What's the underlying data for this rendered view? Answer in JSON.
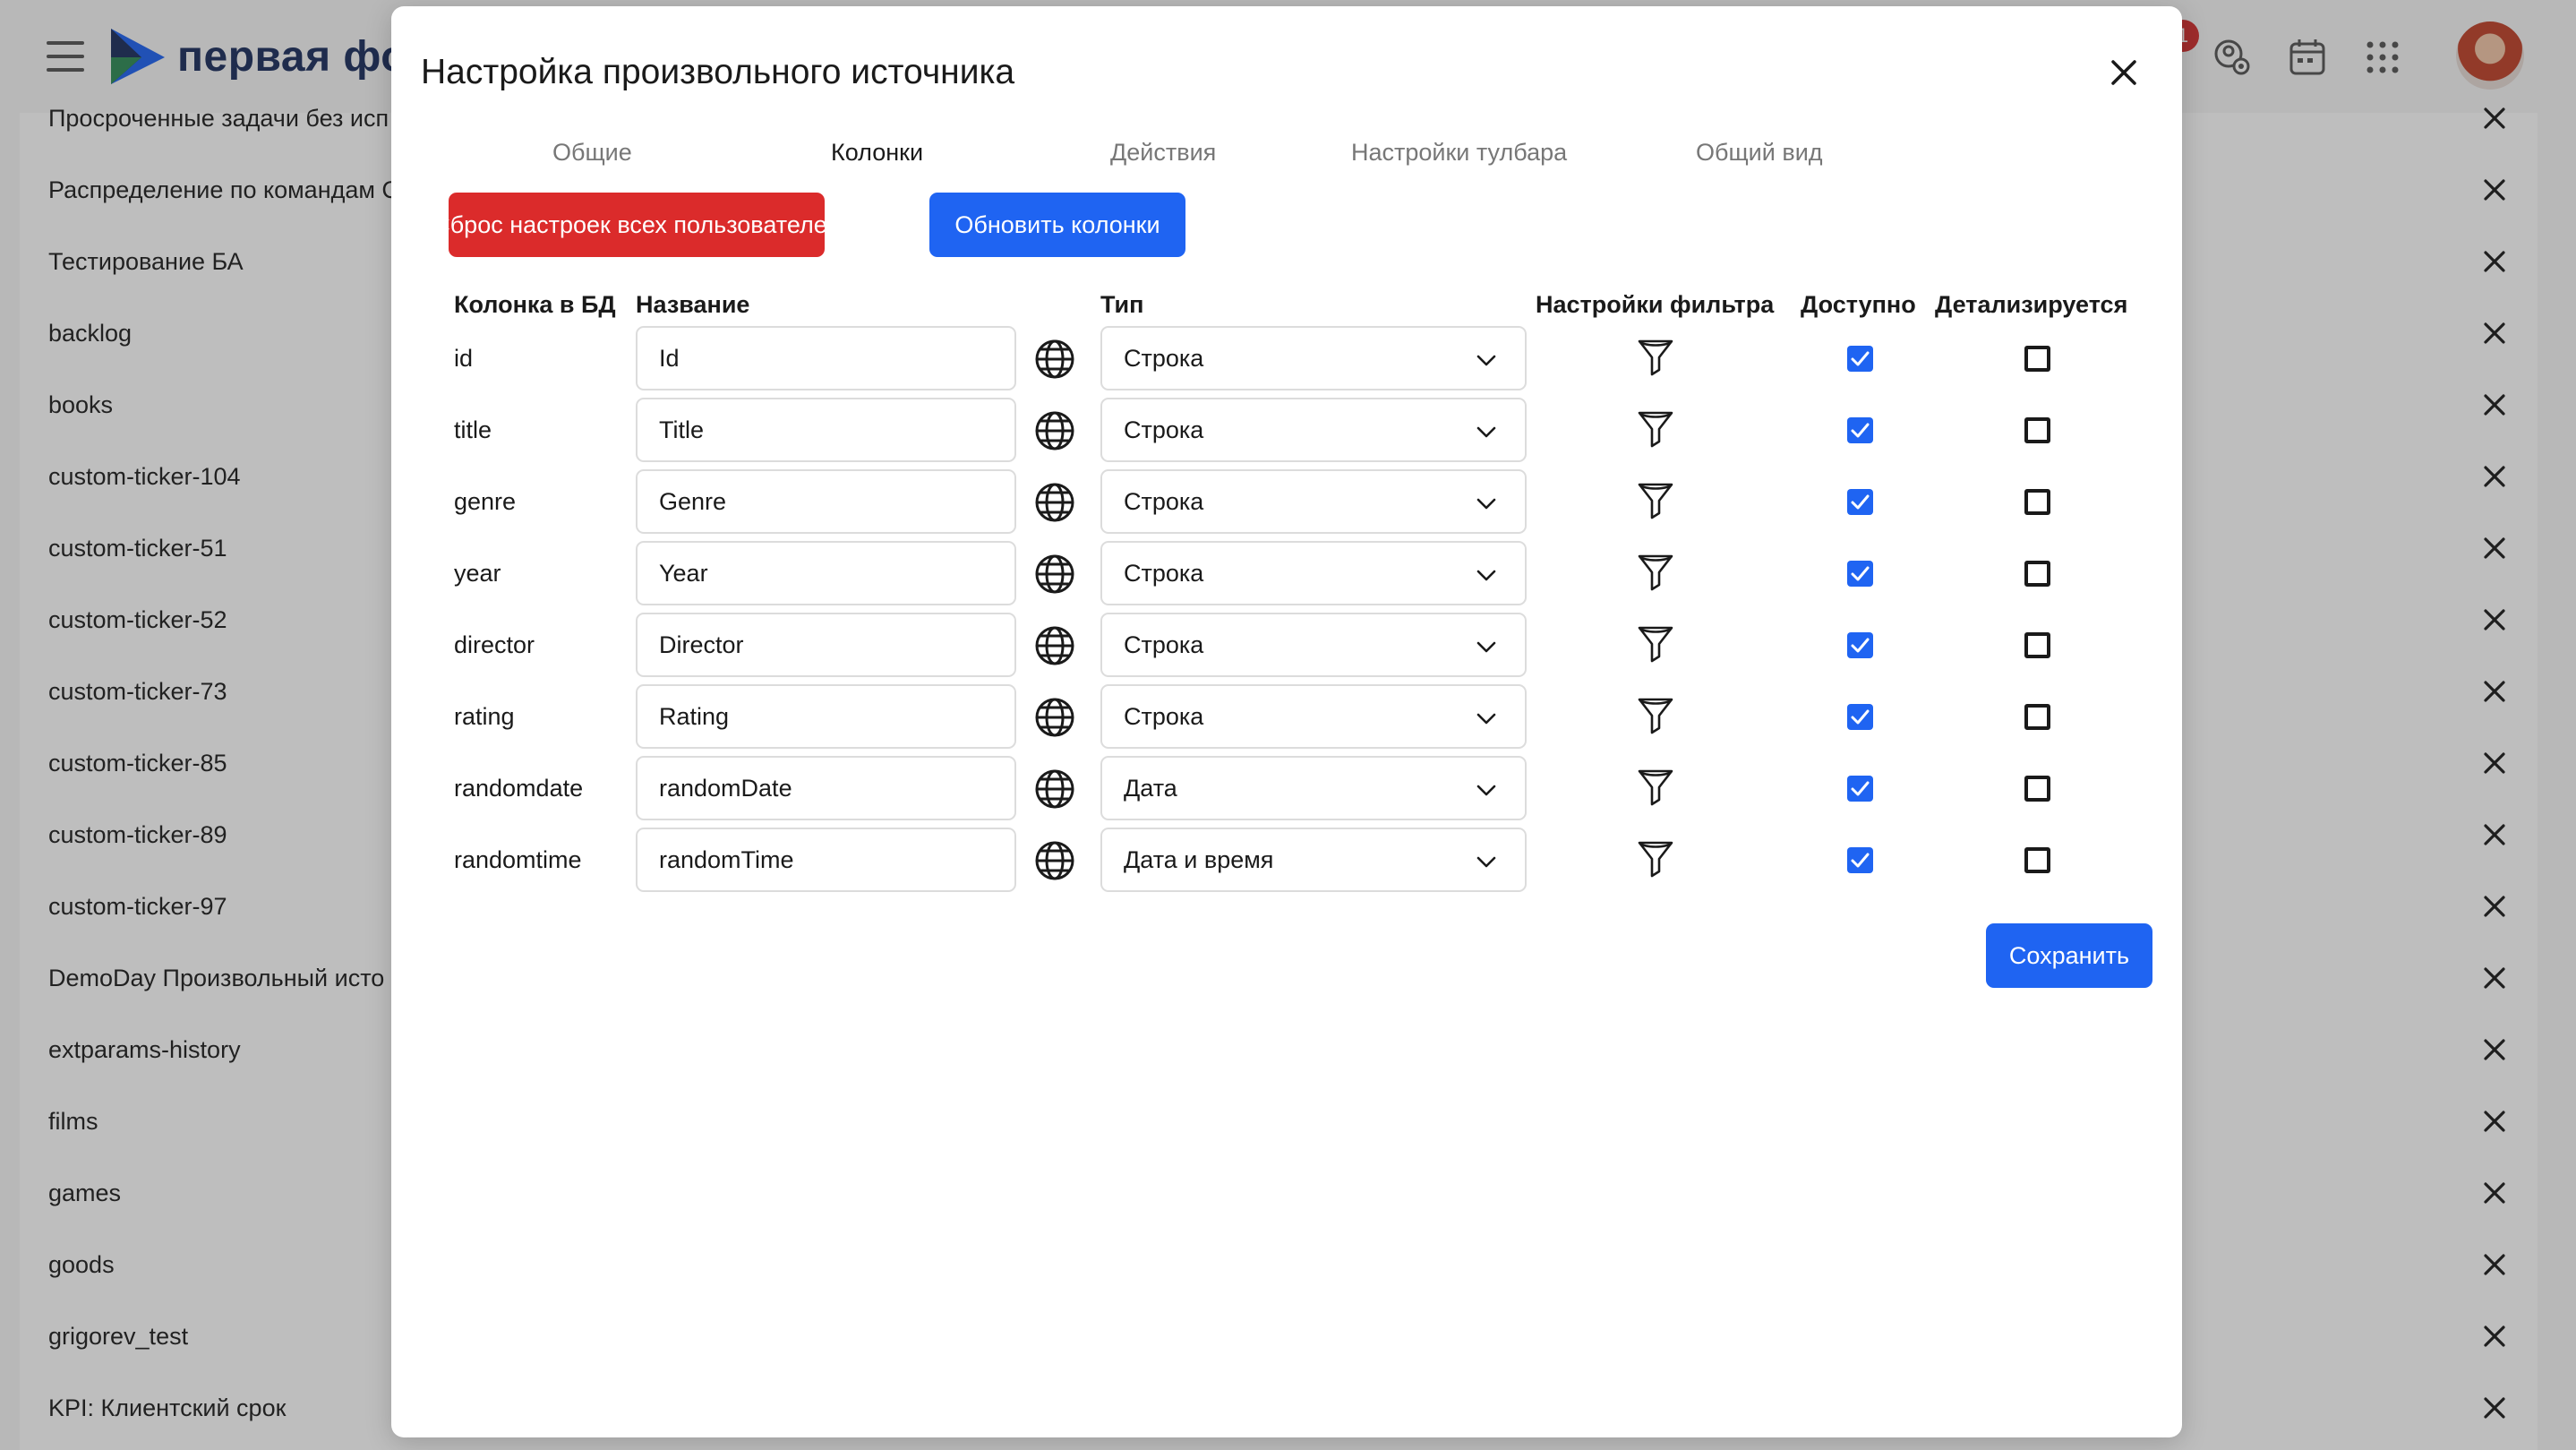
{
  "app": {
    "brand": "первая фор",
    "notification_count": "1"
  },
  "background_list": [
    "Просроченные задачи без исп",
    "Распределение по командам С",
    "Тестирование БА",
    "backlog",
    "books",
    "custom-ticker-104",
    "custom-ticker-51",
    "custom-ticker-52",
    "custom-ticker-73",
    "custom-ticker-85",
    "custom-ticker-89",
    "custom-ticker-97",
    "DemoDay Произвольный исто",
    "extparams-history",
    "films",
    "games",
    "goods",
    "grigorev_test",
    "KPI: Клиентский срок"
  ],
  "modal": {
    "title": "Настройка произвольного источника",
    "tabs": [
      {
        "label": "Общие",
        "active": false
      },
      {
        "label": "Колонки",
        "active": true
      },
      {
        "label": "Действия",
        "active": false
      },
      {
        "label": "Настройки тулбара",
        "active": false
      },
      {
        "label": "Общий вид",
        "active": false
      }
    ],
    "reset_button": "Сброс настроек всех пользователей",
    "refresh_button": "Обновить колонки",
    "save_button": "Сохранить",
    "columns_header": {
      "db_column": "Колонка в БД",
      "name": "Название",
      "type": "Тип",
      "filter": "Настройки фильтра",
      "available": "Доступно",
      "drilldown": "Детализируется"
    },
    "rows": [
      {
        "db": "id",
        "name": "Id",
        "type": "Строка",
        "available": true,
        "drilldown": false
      },
      {
        "db": "title",
        "name": "Title",
        "type": "Строка",
        "available": true,
        "drilldown": false
      },
      {
        "db": "genre",
        "name": "Genre",
        "type": "Строка",
        "available": true,
        "drilldown": false
      },
      {
        "db": "year",
        "name": "Year",
        "type": "Строка",
        "available": true,
        "drilldown": false
      },
      {
        "db": "director",
        "name": "Director",
        "type": "Строка",
        "available": true,
        "drilldown": false
      },
      {
        "db": "rating",
        "name": "Rating",
        "type": "Строка",
        "available": true,
        "drilldown": false
      },
      {
        "db": "randomdate",
        "name": "randomDate",
        "type": "Дата",
        "available": true,
        "drilldown": false
      },
      {
        "db": "randomtime",
        "name": "randomTime",
        "type": "Дата и время",
        "available": true,
        "drilldown": false
      }
    ]
  },
  "colors": {
    "primary": "#1f64f2",
    "danger": "#db2b2b",
    "badge": "#d32f2f"
  }
}
